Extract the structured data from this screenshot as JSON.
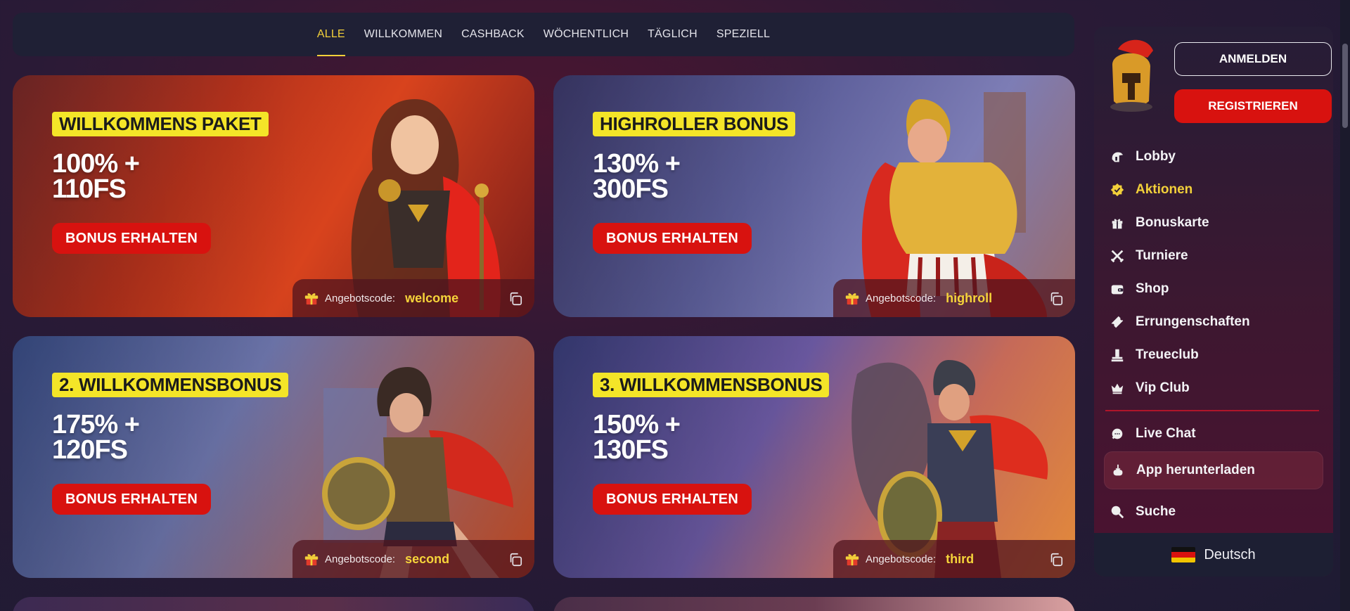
{
  "tabs": [
    {
      "label": "ALLE",
      "active": true
    },
    {
      "label": "WILLKOMMEN"
    },
    {
      "label": "CASHBACK"
    },
    {
      "label": "WÖCHENTLICH"
    },
    {
      "label": "TÄGLICH"
    },
    {
      "label": "SPEZIELL"
    }
  ],
  "cards": [
    {
      "title": "WILLKOMMENS PAKET",
      "amount_line1": "100% +",
      "amount_line2": "110FS",
      "button": "BONUS ERHALTEN",
      "promo_label": "Angebotscode:",
      "promo_code": "welcome"
    },
    {
      "title": "HIGHROLLER BONUS",
      "amount_line1": "130% +",
      "amount_line2": "300FS",
      "button": "BONUS ERHALTEN",
      "promo_label": "Angebotscode:",
      "promo_code": "highroll"
    },
    {
      "title": "2. WILLKOMMENSBONUS",
      "amount_line1": "175% +",
      "amount_line2": "120FS",
      "button": "BONUS ERHALTEN",
      "promo_label": "Angebotscode:",
      "promo_code": "second"
    },
    {
      "title": "3. WILLKOMMENSBONUS",
      "amount_line1": "150% +",
      "amount_line2": "130FS",
      "button": "BONUS ERHALTEN",
      "promo_label": "Angebotscode:",
      "promo_code": "third"
    }
  ],
  "sidebar": {
    "login": "ANMELDEN",
    "register": "REGISTRIEREN",
    "menu": [
      {
        "label": "Lobby",
        "icon": "spartan-helmet-icon"
      },
      {
        "label": "Aktionen",
        "icon": "badge-icon",
        "active": true
      },
      {
        "label": "Bonuskarte",
        "icon": "gift-icon"
      },
      {
        "label": "Turniere",
        "icon": "crossed-swords-icon"
      },
      {
        "label": "Shop",
        "icon": "wallet-icon"
      },
      {
        "label": "Errungenschaften",
        "icon": "ticket-icon"
      },
      {
        "label": "Treueclub",
        "icon": "podium-icon"
      },
      {
        "label": "Vip Club",
        "icon": "crown-icon"
      }
    ],
    "menu_bottom": [
      {
        "label": "Live Chat",
        "icon": "chat-icon"
      },
      {
        "label": "App herunterladen",
        "icon": "download-icon"
      },
      {
        "label": "Suche",
        "icon": "search-icon"
      }
    ],
    "language": "Deutsch"
  },
  "colors": {
    "accent_yellow": "#f2d03a",
    "button_red": "#d8120f",
    "title_badge": "#f4e528"
  }
}
